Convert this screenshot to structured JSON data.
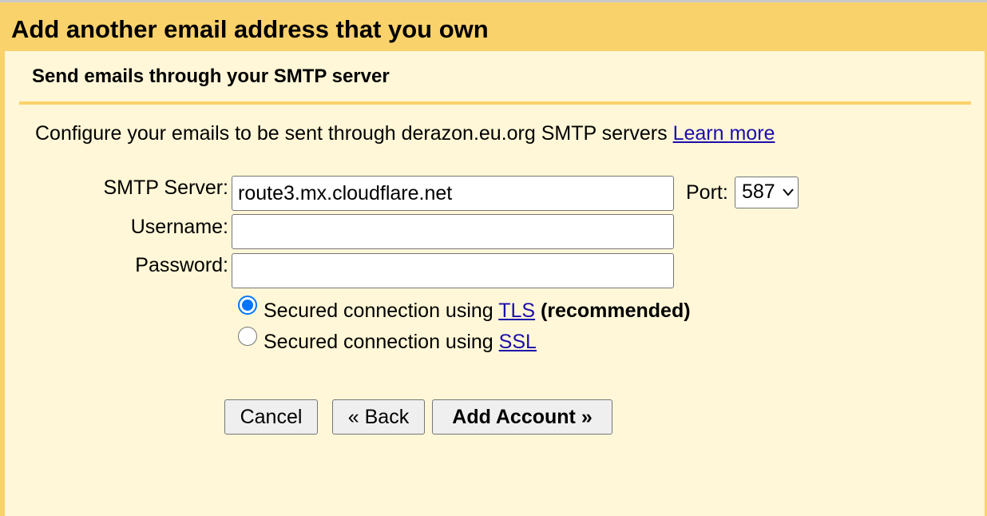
{
  "dialog": {
    "title": "Add another email address that you own"
  },
  "section": {
    "title": "Send emails through your SMTP server",
    "description": "Configure your emails to be sent through derazon.eu.org SMTP servers",
    "learn_more": "Learn more"
  },
  "form": {
    "smtp_server": {
      "label": "SMTP Server:",
      "value": "route3.mx.cloudflare.net"
    },
    "port": {
      "label": "Port:",
      "value": "587"
    },
    "username": {
      "label": "Username:",
      "value": ""
    },
    "password": {
      "label": "Password:",
      "value": ""
    }
  },
  "security": {
    "tls": {
      "prefix": "Secured connection using",
      "link": "TLS",
      "suffix": "(recommended)",
      "selected": true
    },
    "ssl": {
      "prefix": "Secured connection using",
      "link": "SSL",
      "selected": false
    }
  },
  "buttons": {
    "cancel": "Cancel",
    "back": "« Back",
    "add_account": "Add Account »"
  },
  "colors": {
    "header_bg": "#fad26b",
    "panel_bg": "#fff7d7",
    "link": "#1a0dab",
    "radio_accent": "#0075ff"
  }
}
